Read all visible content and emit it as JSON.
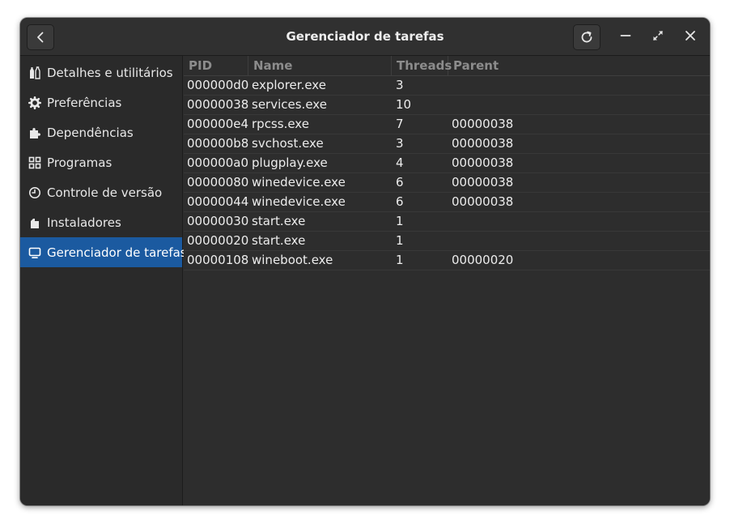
{
  "window": {
    "title": "Gerenciador de tarefas"
  },
  "header": {
    "back_icon": "chevron-left-icon",
    "refresh_icon": "refresh-icon",
    "minimize_icon": "minimize-icon",
    "maximize_icon": "maximize-icon",
    "close_icon": "close-icon"
  },
  "sidebar": {
    "items": [
      {
        "label": "Detalhes e utilitários",
        "icon": "bottles-icon",
        "active": false
      },
      {
        "label": "Preferências",
        "icon": "gear-icon",
        "active": false
      },
      {
        "label": "Dependências",
        "icon": "puzzle-icon",
        "active": false
      },
      {
        "label": "Programas",
        "icon": "apps-grid-icon",
        "active": false
      },
      {
        "label": "Controle de versão",
        "icon": "history-icon",
        "active": false
      },
      {
        "label": "Instaladores",
        "icon": "package-icon",
        "active": false
      },
      {
        "label": "Gerenciador de tarefas",
        "icon": "monitor-icon",
        "active": true
      }
    ]
  },
  "table": {
    "columns": [
      "PID",
      "Name",
      "Threads",
      "Parent"
    ],
    "rows": [
      {
        "pid": "000000d0",
        "name": "explorer.exe",
        "threads": "3",
        "parent": ""
      },
      {
        "pid": "00000038",
        "name": "services.exe",
        "threads": "10",
        "parent": ""
      },
      {
        "pid": "000000e4",
        "name": "rpcss.exe",
        "threads": "7",
        "parent": "00000038"
      },
      {
        "pid": "000000b8",
        "name": "svchost.exe",
        "threads": "3",
        "parent": "00000038"
      },
      {
        "pid": "000000a0",
        "name": "plugplay.exe",
        "threads": "4",
        "parent": "00000038"
      },
      {
        "pid": "00000080",
        "name": "winedevice.exe",
        "threads": "6",
        "parent": "00000038"
      },
      {
        "pid": "00000044",
        "name": "winedevice.exe",
        "threads": "6",
        "parent": "00000038"
      },
      {
        "pid": "00000030",
        "name": "start.exe",
        "threads": "1",
        "parent": ""
      },
      {
        "pid": "00000020",
        "name": "start.exe",
        "threads": "1",
        "parent": ""
      },
      {
        "pid": "00000108",
        "name": "wineboot.exe",
        "threads": "1",
        "parent": "00000020"
      }
    ]
  },
  "colors": {
    "accent": "#1b5aa0",
    "window_bg": "#2d2d2d",
    "sidebar_bg": "#2a2a2a"
  }
}
